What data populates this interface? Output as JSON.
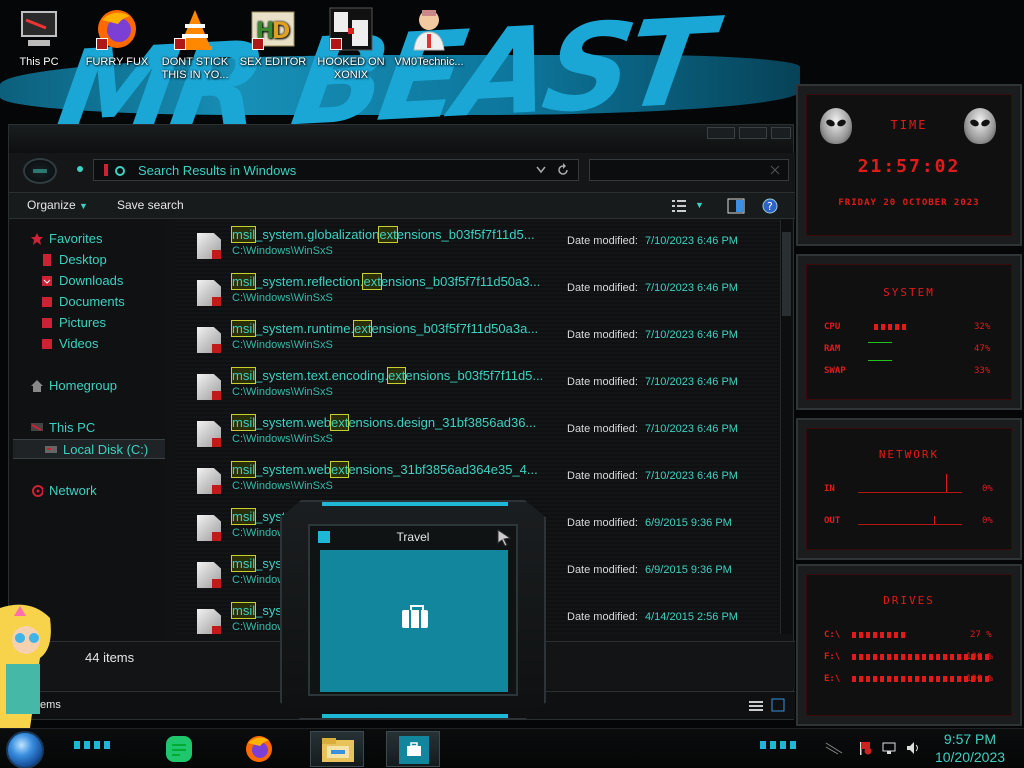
{
  "desktop": {
    "wallpaper_text": "MR BEAST",
    "icons": [
      {
        "label": "This PC",
        "icon": "computer-icon"
      },
      {
        "label": "FURRY FUX",
        "icon": "firefox-icon"
      },
      {
        "label": "DONT STICK THIS IN YO...",
        "icon": "vlc-icon"
      },
      {
        "label": "SEX EDITOR",
        "icon": "hxd-icon"
      },
      {
        "label": "HOOKED ON XONIX",
        "icon": "game-icon"
      },
      {
        "label": "VM0Technic...",
        "icon": "doctor-icon"
      }
    ]
  },
  "explorer": {
    "address": "Search Results in Windows",
    "toolbar": {
      "organize": "Organize",
      "save_search": "Save search"
    },
    "nav": {
      "favorites": "Favorites",
      "desktop": "Desktop",
      "downloads": "Downloads",
      "documents": "Documents",
      "pictures": "Pictures",
      "videos": "Videos",
      "homegroup": "Homegroup",
      "this_pc": "This PC",
      "local_disk": "Local Disk (C:)",
      "network": "Network"
    },
    "date_label": "Date modified:",
    "files": [
      {
        "pre": "",
        "m1": "msil",
        "mid": "_system.globalization",
        "m2": "ext",
        "post": "ensions_b03f5f7f11d5...",
        "path": "C:\\Windows\\WinSxS",
        "date": "7/10/2023 6:46 PM"
      },
      {
        "pre": "",
        "m1": "msil",
        "mid": "_system.reflection.",
        "m2": "ext",
        "post": "ensions_b03f5f7f11d50a3...",
        "path": "C:\\Windows\\WinSxS",
        "date": "7/10/2023 6:46 PM"
      },
      {
        "pre": "",
        "m1": "msil",
        "mid": "_system.runtime.",
        "m2": "ext",
        "post": "ensions_b03f5f7f11d50a3a...",
        "path": "C:\\Windows\\WinSxS",
        "date": "7/10/2023 6:46 PM"
      },
      {
        "pre": "",
        "m1": "msil",
        "mid": "_system.text.encoding.",
        "m2": "ext",
        "post": "ensions_b03f5f7f11d5...",
        "path": "C:\\Windows\\WinSxS",
        "date": "7/10/2023 6:46 PM"
      },
      {
        "pre": "",
        "m1": "msil",
        "mid": "_system.web",
        "m2": "ext",
        "post": "ensions.design_31bf3856ad36...",
        "path": "C:\\Windows\\WinSxS",
        "date": "7/10/2023 6:46 PM"
      },
      {
        "pre": "",
        "m1": "msil",
        "mid": "_system.web",
        "m2": "ext",
        "post": "ensions_31bf3856ad364e35_4...",
        "path": "C:\\Windows\\WinSxS",
        "date": "7/10/2023 6:46 PM"
      },
      {
        "pre": "",
        "m1": "msil",
        "mid": "_syste",
        "m2": "",
        "post": "",
        "path": "C:\\Windows",
        "date": "6/9/2015 9:36 PM"
      },
      {
        "pre": "",
        "m1": "msil",
        "mid": "_syste",
        "m2": "",
        "post": "",
        "path": "C:\\Windows",
        "date": "6/9/2015 9:36 PM"
      },
      {
        "pre": "",
        "m1": "msil",
        "mid": "_syste",
        "m2": "",
        "post": "",
        "path": "C:\\Windows",
        "date": "4/14/2015 2:56 PM"
      }
    ],
    "item_count": "44 items",
    "status_text": "tems"
  },
  "travel": {
    "title": "Travel"
  },
  "gadgets": {
    "time": {
      "title": "TIME",
      "clock": "21:57:02",
      "date": "FRIDAY 20 OCTOBER 2023"
    },
    "system": {
      "title": "SYSTEM",
      "cpu_label": "CPU",
      "ram_label": "RAM",
      "swap_label": "SWAP",
      "cpu": "32%",
      "ram": "47%",
      "swap": "33%"
    },
    "network": {
      "title": "NETWORK",
      "in_label": "IN",
      "out_label": "OUT",
      "in": "0%",
      "out": "0%"
    },
    "drives": {
      "title": "DRIVES",
      "c_label": "C:\\",
      "f_label": "F:\\",
      "e_label": "E:\\",
      "c": "27 %",
      "f": "100 %",
      "e": "100 %"
    }
  },
  "taskbar": {
    "time": "9:57 PM",
    "date": "10/20/2023"
  },
  "colors": {
    "accent": "#3dd1c2",
    "highlight": "#c7cf33",
    "gadget_red": "#e21a1a",
    "taskbar_cyan": "#1fb7d6"
  }
}
